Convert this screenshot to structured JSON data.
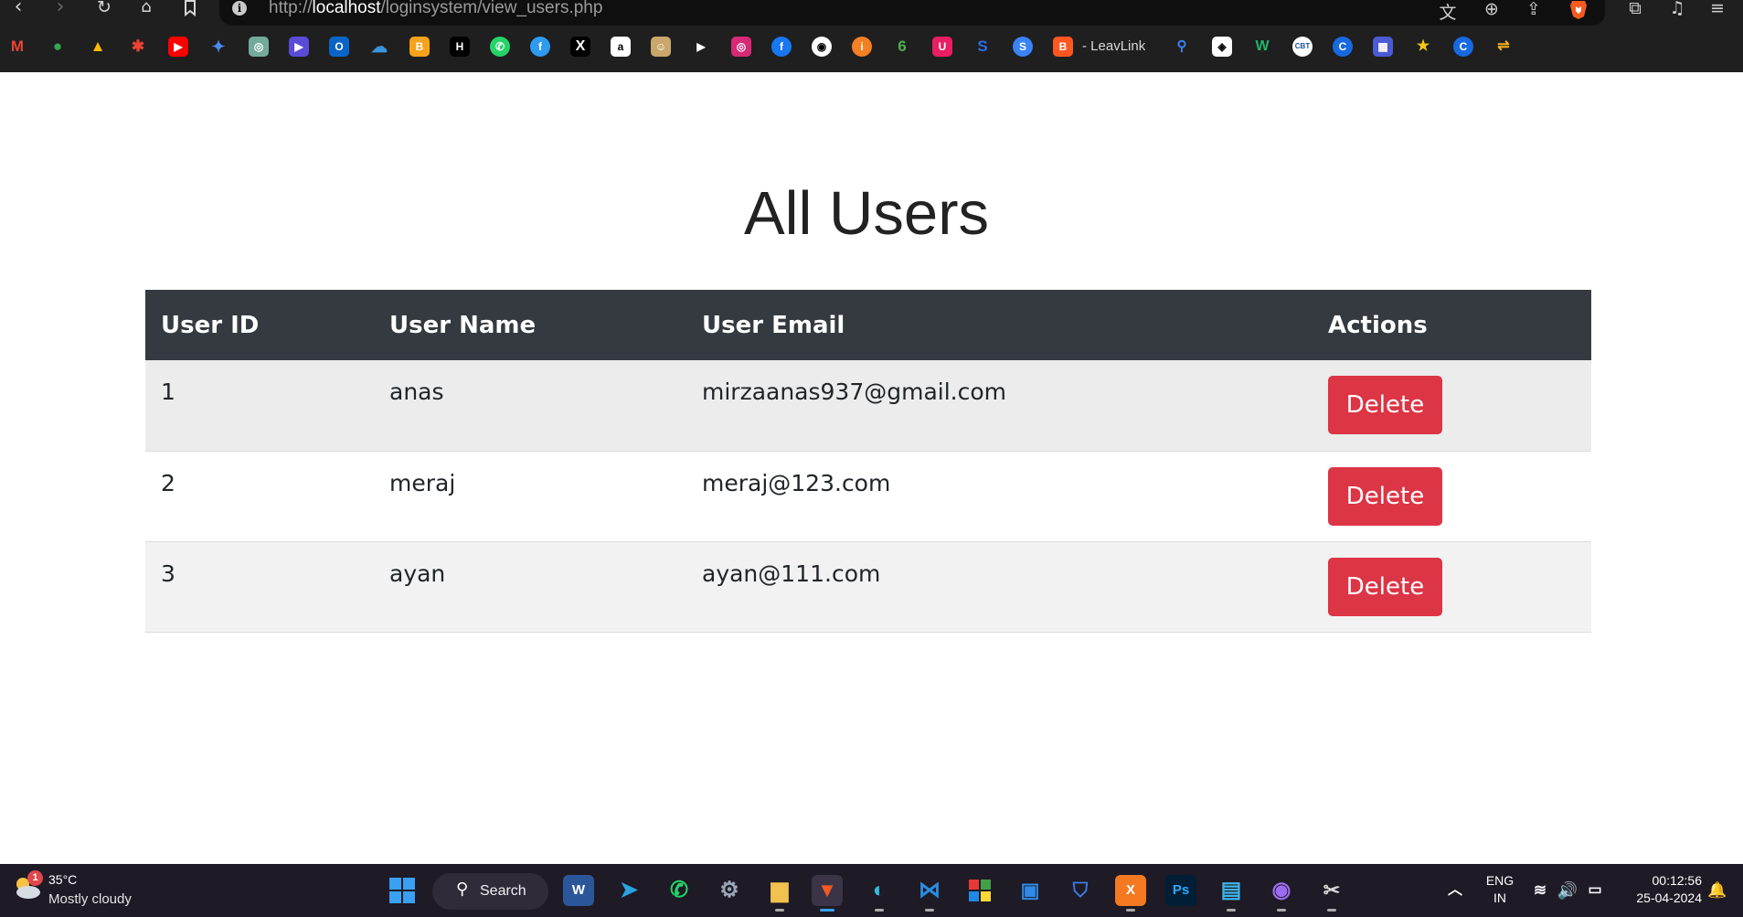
{
  "browser": {
    "url_prefix": "http://",
    "url_host": "localhost",
    "url_path": "/loginsystem/view_users.php",
    "bookmark_text": "- LeavLink"
  },
  "page": {
    "title": "All Users",
    "columns": [
      "User ID",
      "User Name",
      "User Email",
      "Actions"
    ],
    "users": [
      {
        "id": "1",
        "name": "anas",
        "email": "mirzaanas937@gmail.com",
        "action": "Delete"
      },
      {
        "id": "2",
        "name": "meraj",
        "email": "meraj@123.com",
        "action": "Delete"
      },
      {
        "id": "3",
        "name": "ayan",
        "email": "ayan@111.com",
        "action": "Delete"
      }
    ]
  },
  "taskbar": {
    "weather_temp": "35°C",
    "weather_desc": "Mostly cloudy",
    "weather_badge": "1",
    "search_label": "Search",
    "lang_top": "ENG",
    "lang_bottom": "IN",
    "time": "00:12:56",
    "date": "25-04-2024"
  },
  "colors": {
    "header_bg": "#343a40",
    "delete_btn": "#dc3545",
    "browser_bg": "#1f1f1f",
    "taskbar_bg": "#1e1a26"
  }
}
